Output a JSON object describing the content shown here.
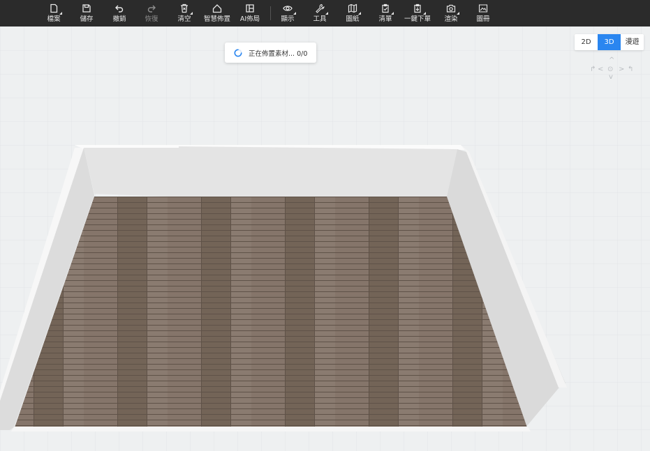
{
  "toolbar": {
    "items": [
      {
        "label": "檔案",
        "icon": "file-icon",
        "dropdown": true,
        "enabled": true
      },
      {
        "label": "儲存",
        "icon": "save-icon",
        "dropdown": false,
        "enabled": true
      },
      {
        "label": "撤銷",
        "icon": "undo-icon",
        "dropdown": false,
        "enabled": true
      },
      {
        "label": "恢復",
        "icon": "redo-icon",
        "dropdown": false,
        "enabled": false
      },
      {
        "label": "清空",
        "icon": "clear-icon",
        "dropdown": true,
        "enabled": true
      },
      {
        "label": "智慧佈置",
        "icon": "smart-layout-icon",
        "dropdown": false,
        "enabled": true
      },
      {
        "label": "AI佈局",
        "icon": "ai-layout-icon",
        "dropdown": false,
        "enabled": true
      },
      {
        "label": "顯示",
        "icon": "eye-icon",
        "dropdown": true,
        "enabled": true
      },
      {
        "label": "工具",
        "icon": "wrench-icon",
        "dropdown": true,
        "enabled": true
      },
      {
        "label": "圖紙",
        "icon": "map-icon",
        "dropdown": true,
        "enabled": true
      },
      {
        "label": "清單",
        "icon": "clipboard-check-icon",
        "dropdown": true,
        "enabled": true
      },
      {
        "label": "一鍵下單",
        "icon": "order-icon",
        "dropdown": true,
        "enabled": true
      },
      {
        "label": "渲染",
        "icon": "camera-icon",
        "dropdown": true,
        "enabled": true
      },
      {
        "label": "圖冊",
        "icon": "album-icon",
        "dropdown": false,
        "enabled": true
      }
    ]
  },
  "loading": {
    "message": "正在佈置素材... 0/0",
    "icon": "spinner-icon",
    "color": "#2a86f0"
  },
  "view_switch": {
    "options": [
      {
        "label": "2D",
        "active": false
      },
      {
        "label": "3D",
        "active": true
      },
      {
        "label": "漫遊",
        "active": false
      }
    ],
    "active_color": "#2a86f0"
  },
  "nav_control": {
    "up": "^",
    "down": "v",
    "left": "<",
    "right": ">",
    "center": "⊙",
    "rotate_left": "↱",
    "rotate_right": "↰"
  },
  "colors": {
    "toolbar_bg": "#2b2b2b",
    "canvas_bg": "#eef0f1",
    "floor": "#7d6d60",
    "wall": "#e3e3e3",
    "wall_top": "#ffffff"
  }
}
